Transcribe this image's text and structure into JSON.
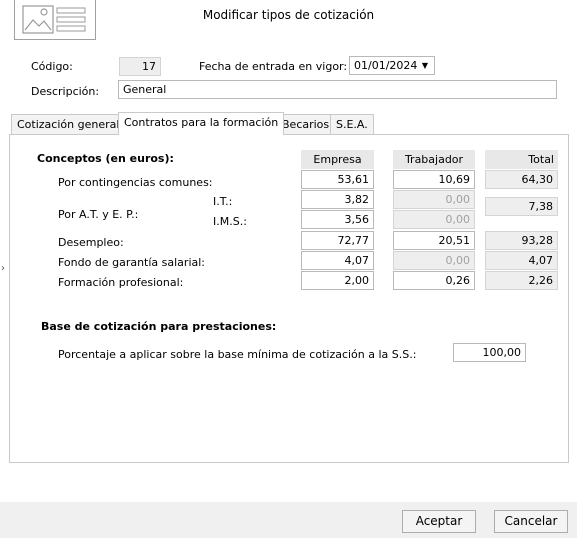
{
  "window": {
    "title": "Modificar tipos de cotización"
  },
  "form": {
    "codigo_label": "Código:",
    "codigo_value": "17",
    "fecha_label": "Fecha de entrada en vigor:",
    "fecha_value": "01/01/2024",
    "descripcion_label": "Descripción:",
    "descripcion_value": "General"
  },
  "tabs": [
    {
      "label": "Cotización general",
      "active": false
    },
    {
      "label": "Contratos para la formación",
      "active": true
    },
    {
      "label": "Becarios",
      "active": false
    },
    {
      "label": "S.E.A.",
      "active": false
    }
  ],
  "conceptos": {
    "title": "Conceptos (en euros):",
    "headers": {
      "empresa": "Empresa",
      "trabajador": "Trabajador",
      "total": "Total"
    },
    "rows": {
      "contingencias": {
        "label": "Por contingencias comunes:",
        "empresa": "53,61",
        "trabajador": "10,69",
        "total": "64,30"
      },
      "at_ep": {
        "label": "Por A.T. y E. P.:",
        "total": "7,38"
      },
      "it": {
        "label": "I.T.:",
        "empresa": "3,82",
        "trabajador": "0,00"
      },
      "ims": {
        "label": "I.M.S.:",
        "empresa": "3,56",
        "trabajador": "0,00"
      },
      "desempleo": {
        "label": "Desempleo:",
        "empresa": "72,77",
        "trabajador": "20,51",
        "total": "93,28"
      },
      "fogasa": {
        "label": "Fondo de garantía salarial:",
        "empresa": "4,07",
        "trabajador": "0,00",
        "total": "4,07"
      },
      "formacion": {
        "label": "Formación profesional:",
        "empresa": "2,00",
        "trabajador": "0,26",
        "total": "2,26"
      }
    }
  },
  "base": {
    "title": "Base de cotización para prestaciones:",
    "porcentaje_label": "Porcentaje a aplicar sobre la base mínima de cotización a la S.S.:",
    "porcentaje_value": "100,00"
  },
  "buttons": {
    "accept": "Aceptar",
    "cancel": "Cancelar"
  }
}
